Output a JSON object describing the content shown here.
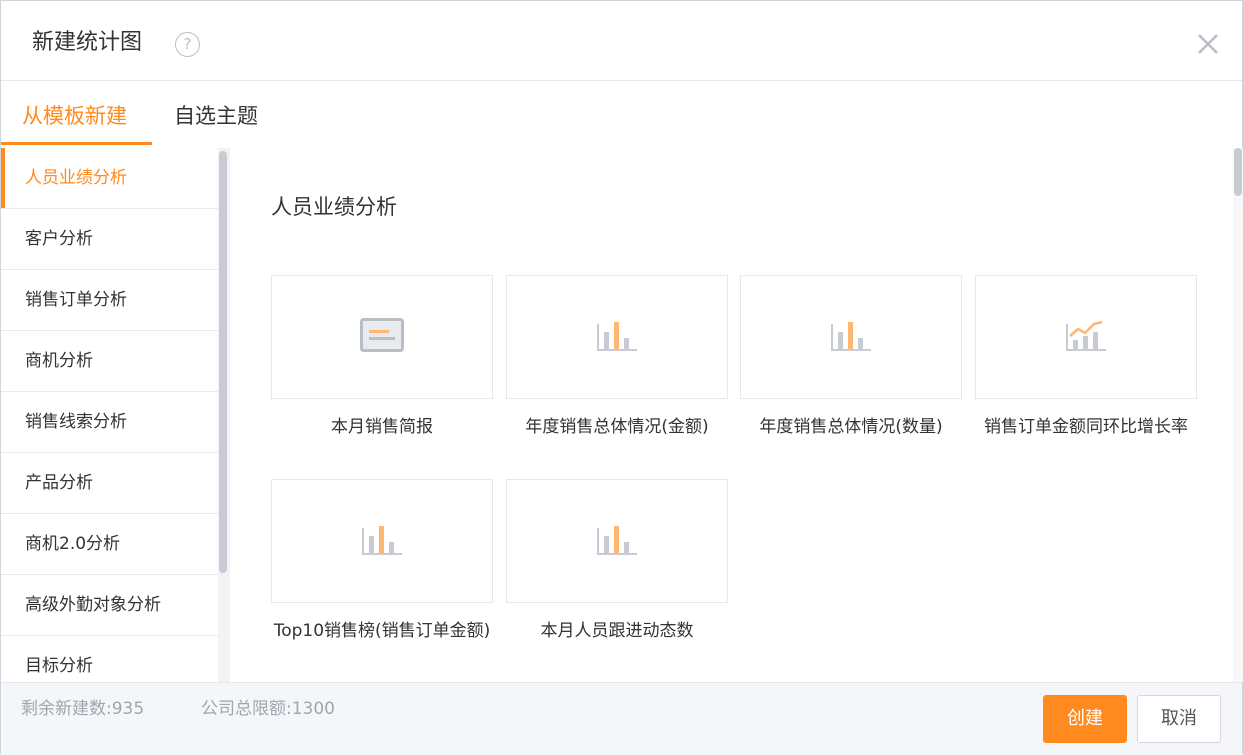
{
  "dialog": {
    "title": "新建统计图",
    "help_icon": "?",
    "close_icon": "close-icon"
  },
  "tabs": [
    {
      "label": "从模板新建",
      "active": true
    },
    {
      "label": "自选主题",
      "active": false
    }
  ],
  "sidebar": {
    "items": [
      {
        "label": "人员业绩分析",
        "active": true
      },
      {
        "label": "客户分析"
      },
      {
        "label": "销售订单分析"
      },
      {
        "label": "商机分析"
      },
      {
        "label": "销售线索分析"
      },
      {
        "label": "产品分析"
      },
      {
        "label": "商机2.0分析"
      },
      {
        "label": "高级外勤对象分析"
      },
      {
        "label": "目标分析"
      }
    ]
  },
  "main": {
    "section_title": "人员业绩分析",
    "templates": [
      {
        "label": "本月销售简报",
        "icon": "report-icon"
      },
      {
        "label": "年度销售总体情况(金额)",
        "icon": "bar-chart-icon"
      },
      {
        "label": "年度销售总体情况(数量)",
        "icon": "bar-chart-icon"
      },
      {
        "label": "销售订单金额同环比增长率",
        "icon": "bar-line-chart-icon"
      },
      {
        "label": "Top10销售榜(销售订单金额)",
        "icon": "bar-chart-icon"
      },
      {
        "label": "本月人员跟进动态数",
        "icon": "bar-chart-icon"
      }
    ]
  },
  "footer": {
    "remaining": "剩余新建数:935",
    "limit": "公司总限额:1300",
    "create_label": "创建",
    "cancel_label": "取消"
  },
  "colors": {
    "accent": "#ff8a1f",
    "icon_gray": "#b9bec6"
  }
}
